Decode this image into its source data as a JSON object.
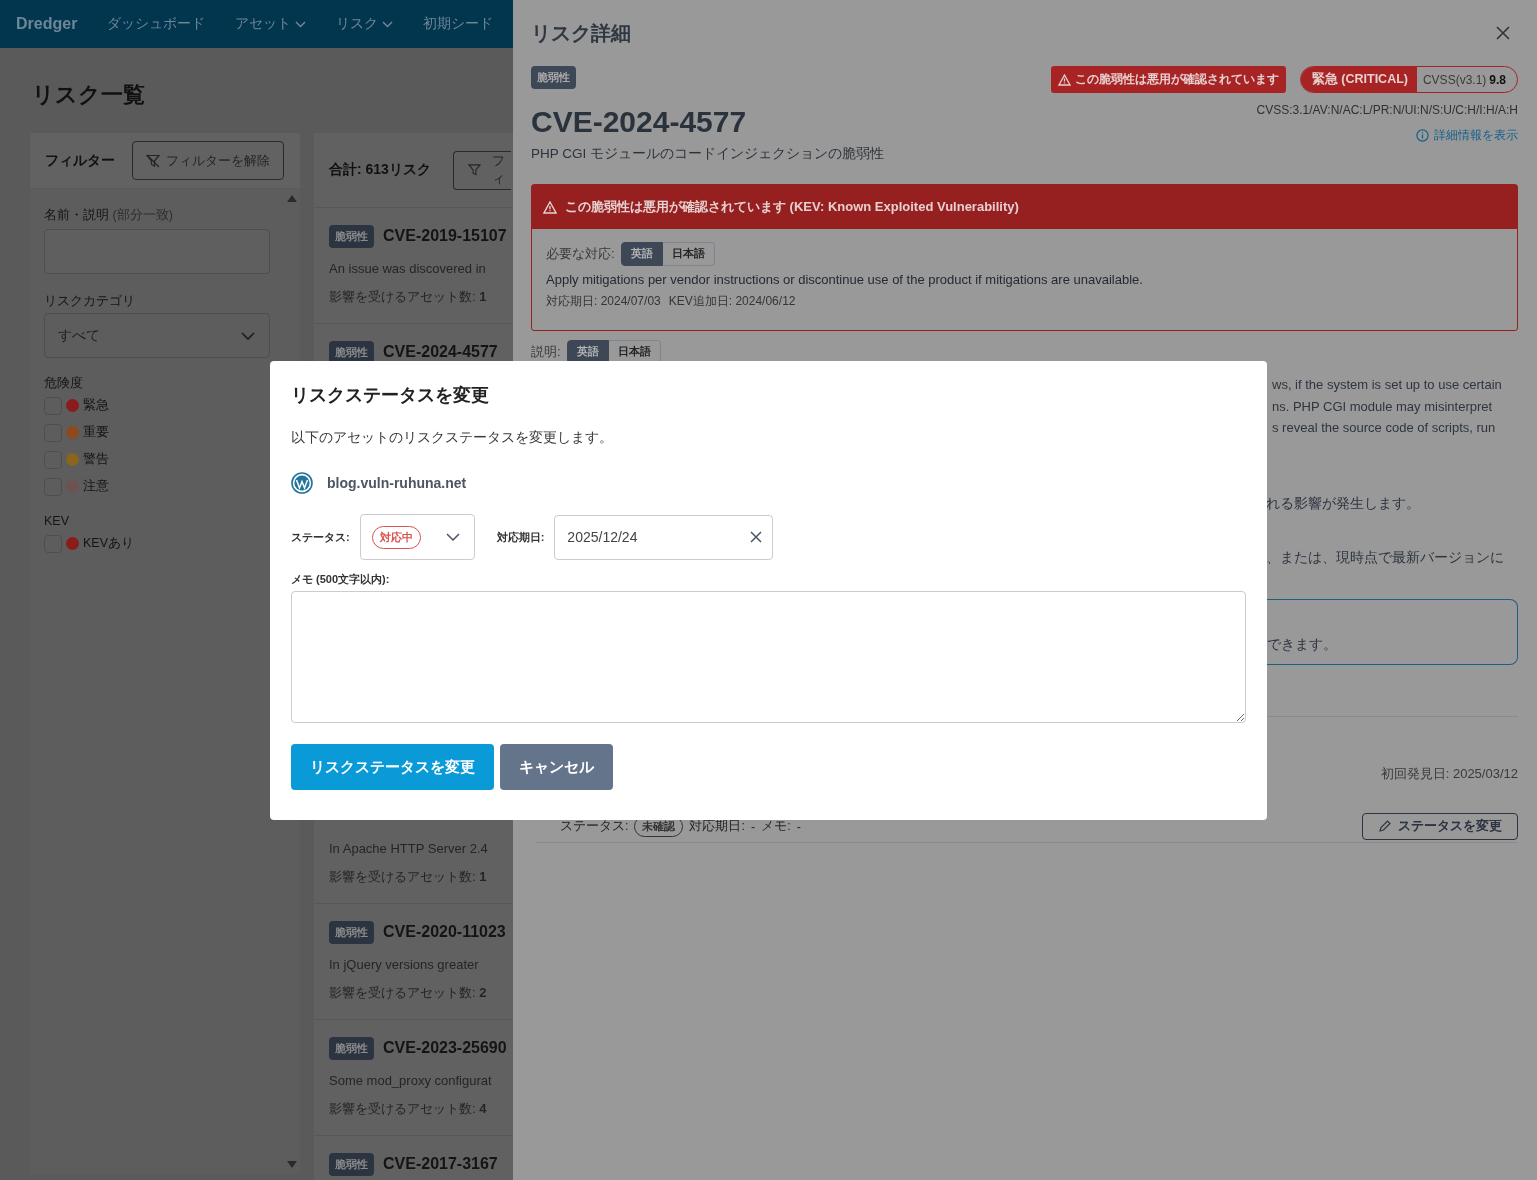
{
  "navbar": {
    "brand": "Dredger",
    "items": [
      {
        "label": "ダッシュボード",
        "dropdown": false
      },
      {
        "label": "アセット",
        "dropdown": true
      },
      {
        "label": "リスク",
        "dropdown": true
      },
      {
        "label": "初期シード",
        "dropdown": false
      }
    ]
  },
  "page": {
    "title": "リスク一覧"
  },
  "filters": {
    "title": "フィルター",
    "clear_button": "フィルターを解除",
    "name_label": "名前・説明",
    "name_hint": "(部分一致)",
    "category_label": "リスクカテゴリ",
    "category_value": "すべて",
    "severity_label": "危険度",
    "severity_options": [
      {
        "label": "緊急",
        "color": "#8b1c1c",
        "checked": false
      },
      {
        "label": "重要",
        "color": "#8e4a1e",
        "checked": false
      },
      {
        "label": "警告",
        "color": "#8a661c",
        "checked": false
      },
      {
        "label": "注意",
        "color": "#6e5252",
        "checked": false
      }
    ],
    "kev_label": "KEV",
    "kev_options": [
      {
        "label": "KEVあり",
        "color": "#8b1c1c",
        "checked": false
      }
    ]
  },
  "risk_list": {
    "total": "合計: 613リスク",
    "filter_button": "フィ",
    "items": [
      {
        "badge": "脆弱性",
        "title": "CVE-2019-15107",
        "description": "An issue was discovered in",
        "affected_label": "影響を受けるアセット数:",
        "affected_count": "1"
      },
      {
        "badge": "脆弱性",
        "title": "CVE-2024-4577"
      },
      {
        "description": "In Apache HTTP Server 2.4",
        "affected_label": "影響を受けるアセット数:",
        "affected_count": "1"
      },
      {
        "badge": "脆弱性",
        "title": "CVE-2020-11023",
        "description": "In jQuery versions greater",
        "affected_label": "影響を受けるアセット数:",
        "affected_count": "2"
      },
      {
        "badge": "脆弱性",
        "title": "CVE-2023-25690",
        "description": "Some mod_proxy configurat",
        "affected_label": "影響を受けるアセット数:",
        "affected_count": "4"
      },
      {
        "badge": "脆弱性",
        "title": "CVE-2017-3167"
      }
    ]
  },
  "detail": {
    "title": "リスク詳細",
    "category_badge": "脆弱性",
    "exploited_badge": "この脆弱性は悪用が確認されています",
    "severity": "緊急 (CRITICAL)",
    "cvss_label": "CVSS(v3.1)",
    "cvss_score": "9.8",
    "vector": "CVSS:3.1/AV:N/AC:L/PR:N/UI:N/S:U/C:H/I:H/A:H",
    "details_link": "詳細情報を表示",
    "cve": "CVE-2024-4577",
    "subtitle": "PHP CGI モジュールのコードインジェクションの脆弱性",
    "kev": {
      "heading": "この脆弱性は悪用が確認されています (KEV: Known Exploited Vulnerability)",
      "action_label": "必要な対応:",
      "languages": [
        {
          "label": "英語",
          "selected": true
        },
        {
          "label": "日本語",
          "selected": false
        }
      ],
      "action_text": "Apply mitigations per vendor instructions or discontinue use of the product if mitigations are unavailable.",
      "due": "対応期日: 2024/07/03",
      "added": "KEV追加日: 2024/06/12"
    },
    "description_label": "説明:",
    "description_languages": [
      {
        "label": "英語",
        "selected": true
      },
      {
        "label": "日本語",
        "selected": false
      }
    ],
    "description_fragments": [
      "ws, if the system is set up to use certain",
      "ns. PHP CGI module may misinterpret",
      "s reveal the source code of scripts, run"
    ],
    "impact_fragment": "れる影響が発生します。",
    "remedy_fragment": "、または、現時点で最新バージョンに",
    "note_fragment": "できます。",
    "first_seen": "初回発見日: 2025/03/12",
    "asset_status": {
      "status_label": "ステータス:",
      "status": "未確認",
      "due_label": "対応期日:",
      "due": "-",
      "memo_label": "メモ:",
      "memo": "-"
    },
    "change_button": "ステータスを変更"
  },
  "dialog": {
    "title": "リスクステータスを変更",
    "message": "以下のアセットのリスクステータスを変更します。",
    "asset": "blog.vuln-ruhuna.net",
    "status_label": "ステータス:",
    "status_value": "対応中",
    "due_label": "対応期日:",
    "due_value": "2025/12/24",
    "memo_label": "メモ (500文字以内):",
    "buttons": [
      {
        "label": "リスクステータスを変更",
        "kind": "primary"
      },
      {
        "label": "キャンセル",
        "kind": "secondary"
      }
    ]
  }
}
